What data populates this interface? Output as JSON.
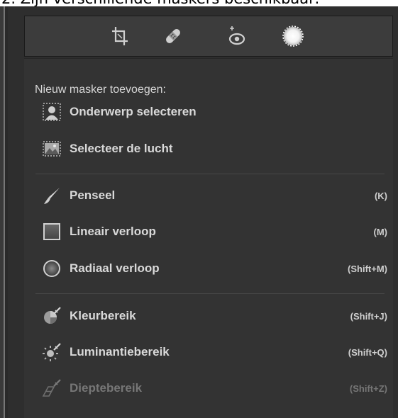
{
  "caption": {
    "text": "2. Zijn verschillende maskers beschikbaar:"
  },
  "toolbar": {
    "tools": [
      {
        "icon": "crop-icon"
      },
      {
        "icon": "healing-bandage-icon"
      },
      {
        "icon": "red-eye-icon"
      },
      {
        "icon": "masking-icon",
        "active": true
      }
    ]
  },
  "panel": {
    "title": "Nieuw masker toevoegen:",
    "items": [
      {
        "label": "Onderwerp selecteren",
        "shortcut": "",
        "icon": "select-subject-icon"
      },
      {
        "label": "Selecteer de lucht",
        "shortcut": "",
        "icon": "select-sky-icon"
      },
      {
        "label": "Penseel",
        "shortcut": "(K)",
        "icon": "brush-icon"
      },
      {
        "label": "Lineair verloop",
        "shortcut": "(M)",
        "icon": "linear-gradient-icon"
      },
      {
        "label": "Radiaal verloop",
        "shortcut": "(Shift+M)",
        "icon": "radial-gradient-icon"
      },
      {
        "label": "Kleurbereik",
        "shortcut": "(Shift+J)",
        "icon": "color-range-icon"
      },
      {
        "label": "Luminantiebereik",
        "shortcut": "(Shift+Q)",
        "icon": "luminance-range-icon"
      },
      {
        "label": "Dieptebereik",
        "shortcut": "(Shift+Z)",
        "icon": "depth-range-icon",
        "disabled": true
      }
    ]
  },
  "colors": {
    "panel_bg": "#333333",
    "toolbar_bg": "#3c3c3c",
    "text": "#d9d9d9",
    "disabled_text": "#767676"
  }
}
